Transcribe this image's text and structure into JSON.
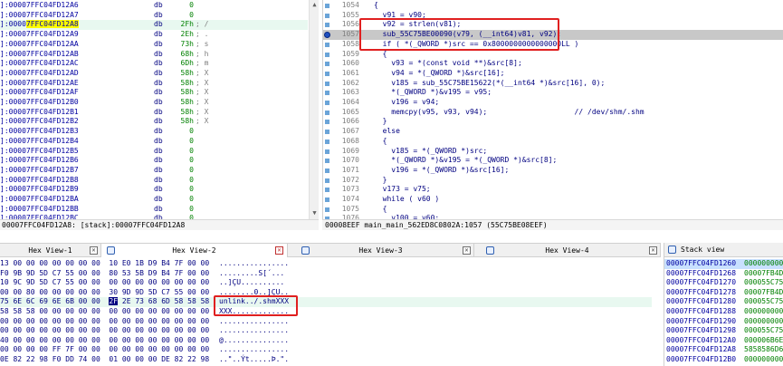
{
  "stack_listing": {
    "rows": [
      {
        "addr": "]:00007FFC04FD12A6",
        "op": "db",
        "val": "0",
        "cmt": ""
      },
      {
        "addr": "]:00007FFC04FD12A7",
        "op": "db",
        "val": "0",
        "cmt": ""
      },
      {
        "addr": "]:00007FFC04FD12A8",
        "op": "db",
        "val": "2Fh",
        "cmt": "; /"
      },
      {
        "addr": "]:00007FFC04FD12A9",
        "op": "db",
        "val": "2Eh",
        "cmt": "; ."
      },
      {
        "addr": "]:00007FFC04FD12AA",
        "op": "db",
        "val": "73h",
        "cmt": "; s"
      },
      {
        "addr": "]:00007FFC04FD12AB",
        "op": "db",
        "val": "68h",
        "cmt": "; h"
      },
      {
        "addr": "]:00007FFC04FD12AC",
        "op": "db",
        "val": "6Dh",
        "cmt": "; m"
      },
      {
        "addr": "]:00007FFC04FD12AD",
        "op": "db",
        "val": "58h",
        "cmt": "; X"
      },
      {
        "addr": "]:00007FFC04FD12AE",
        "op": "db",
        "val": "58h",
        "cmt": "; X"
      },
      {
        "addr": "]:00007FFC04FD12AF",
        "op": "db",
        "val": "58h",
        "cmt": "; X"
      },
      {
        "addr": "]:00007FFC04FD12B0",
        "op": "db",
        "val": "58h",
        "cmt": "; X"
      },
      {
        "addr": "]:00007FFC04FD12B1",
        "op": "db",
        "val": "58h",
        "cmt": "; X"
      },
      {
        "addr": "]:00007FFC04FD12B2",
        "op": "db",
        "val": "58h",
        "cmt": "; X"
      },
      {
        "addr": "]:00007FFC04FD12B3",
        "op": "db",
        "val": "0",
        "cmt": ""
      },
      {
        "addr": "]:00007FFC04FD12B4",
        "op": "db",
        "val": "0",
        "cmt": ""
      },
      {
        "addr": "]:00007FFC04FD12B5",
        "op": "db",
        "val": "0",
        "cmt": ""
      },
      {
        "addr": "]:00007FFC04FD12B6",
        "op": "db",
        "val": "0",
        "cmt": ""
      },
      {
        "addr": "]:00007FFC04FD12B7",
        "op": "db",
        "val": "0",
        "cmt": ""
      },
      {
        "addr": "]:00007FFC04FD12B8",
        "op": "db",
        "val": "0",
        "cmt": ""
      },
      {
        "addr": "]:00007FFC04FD12B9",
        "op": "db",
        "val": "0",
        "cmt": ""
      },
      {
        "addr": "]:00007FFC04FD12BA",
        "op": "db",
        "val": "0",
        "cmt": ""
      },
      {
        "addr": "]:00007FFC04FD12BB",
        "op": "db",
        "val": "0",
        "cmt": ""
      },
      {
        "addr": "]:00007FFC04FD12BC",
        "op": "db",
        "val": "0",
        "cmt": ""
      }
    ],
    "selected_addr_prefix": "]:0000",
    "selected_addr_highlight": "7FFC04FD12A8",
    "status": "00007FFC04FD12A8: [stack]:00007FFC04FD12A8"
  },
  "pseudocode": {
    "lines": [
      {
        "ln": "1054",
        "text": "{"
      },
      {
        "ln": "1055",
        "text": "  v91 = v90;"
      },
      {
        "ln": "1056",
        "text": "  v92 = strlen(v81);"
      },
      {
        "ln": "1057",
        "text": "  sub_55C75BE00090(v79, (__int64)v81, v92);"
      },
      {
        "ln": "1058",
        "text": "  if ( *(_QWORD *)src == 0x8000000000000000LL )"
      },
      {
        "ln": "1059",
        "text": "  {"
      },
      {
        "ln": "1060",
        "text": "    v93 = *(const void **)&src[8];"
      },
      {
        "ln": "1061",
        "text": "    v94 = *(_QWORD *)&src[16];"
      },
      {
        "ln": "1062",
        "text": "    v185 = sub_55C75BE15622(*(__int64 *)&src[16], 0);"
      },
      {
        "ln": "1063",
        "text": "    *(_QWORD *)&v195 = v95;"
      },
      {
        "ln": "1064",
        "text": "    v196 = v94;"
      },
      {
        "ln": "1065",
        "text": "    memcpy(v95, v93, v94);                    // /dev/shm/.shm"
      },
      {
        "ln": "1066",
        "text": "  }"
      },
      {
        "ln": "1067",
        "text": "  else"
      },
      {
        "ln": "1068",
        "text": "  {"
      },
      {
        "ln": "1069",
        "text": "    v185 = *(_QWORD *)src;"
      },
      {
        "ln": "1070",
        "text": "    *(_QWORD *)&v195 = *(_QWORD *)&src[8];"
      },
      {
        "ln": "1071",
        "text": "    v196 = *(_QWORD *)&src[16];"
      },
      {
        "ln": "1072",
        "text": "  }"
      },
      {
        "ln": "1073",
        "text": "  v173 = v75;"
      },
      {
        "ln": "1074",
        "text": "  while ( v60 )"
      },
      {
        "ln": "1075",
        "text": "  {"
      },
      {
        "ln": "1076",
        "text": "    v100 = v60;"
      }
    ],
    "status": "00008EEF main_main_562ED8C0802A:1057 (55C75BE08EEF)"
  },
  "hex_tabs": [
    {
      "label": "Hex View-1",
      "closable": true
    },
    {
      "label": "Hex View-2",
      "closable": true
    },
    {
      "label": "Hex View-3",
      "closable": true
    },
    {
      "label": "Hex View-4",
      "closable": true
    }
  ],
  "hex_view": {
    "rows": [
      {
        "bytes": "13 00 00 00 00 00 00 00  10 E0 1B D9 B4 7F 00 00",
        "ascii": "................"
      },
      {
        "bytes": "F0 9B 9D 5D C7 55 00 00  80 53 5B D9 B4 7F 00 00",
        "ascii": ".........S[´..."
      },
      {
        "bytes": "10 9C 9D 5D C7 55 00 00  00 00 00 00 00 00 00 00",
        "ascii": "..]ÇU.........."
      },
      {
        "bytes": "00 00 80 00 00 00 00 00  30 9D 9D 5D C7 55 00 00",
        "ascii": "........0..]ÇU.."
      },
      {
        "bytes": "75 6E 6C 69 6E 6B 00 00  2F 2E 73 68 6D 58 58 58",
        "ascii": "unlink../.shmXXX"
      },
      {
        "bytes": "58 58 58 00 00 00 00 00  00 00 00 00 00 00 00 00",
        "ascii": "XXX............."
      },
      {
        "bytes": "00 00 00 00 00 00 00 00  00 00 00 00 00 00 00 00",
        "ascii": "................"
      },
      {
        "bytes": "00 00 00 00 00 00 00 00  00 00 00 00 00 00 00 00",
        "ascii": "................"
      },
      {
        "bytes": "40 00 00 00 00 00 00 00  00 00 00 00 00 00 00 00",
        "ascii": "@..............."
      },
      {
        "bytes": "00 00 00 00 FF 7F 00 00  00 00 00 00 00 00 00 00",
        "ascii": "................"
      },
      {
        "bytes": "0E 82 22 98 F0 DD 74 00  01 00 00 00 DE 82 22 98",
        "ascii": "..\"..Ýt.....Þ.\"."
      }
    ]
  },
  "stack_view": {
    "title": "Stack view",
    "rows": [
      {
        "addr": "00007FFC04FD1260",
        "val": "000000000"
      },
      {
        "addr": "00007FFC04FD1268",
        "val": "00007FB4D"
      },
      {
        "addr": "00007FFC04FD1270",
        "val": "000055C75"
      },
      {
        "addr": "00007FFC04FD1278",
        "val": "00007FB4D"
      },
      {
        "addr": "00007FFC04FD1280",
        "val": "000055C75"
      },
      {
        "addr": "00007FFC04FD1288",
        "val": "000000000"
      },
      {
        "addr": "00007FFC04FD1290",
        "val": "000000000"
      },
      {
        "addr": "00007FFC04FD1298",
        "val": "000055C75"
      },
      {
        "addr": "00007FFC04FD12A0",
        "val": "000006B6E6"
      },
      {
        "addr": "00007FFC04FD12A8",
        "val": "5858586D6"
      },
      {
        "addr": "00007FFC04FD12B0",
        "val": "000000000"
      }
    ]
  },
  "colors": {
    "annotation": "#e02020",
    "highlight": "#ffff00",
    "cursor_line": "#c8c8c8"
  }
}
